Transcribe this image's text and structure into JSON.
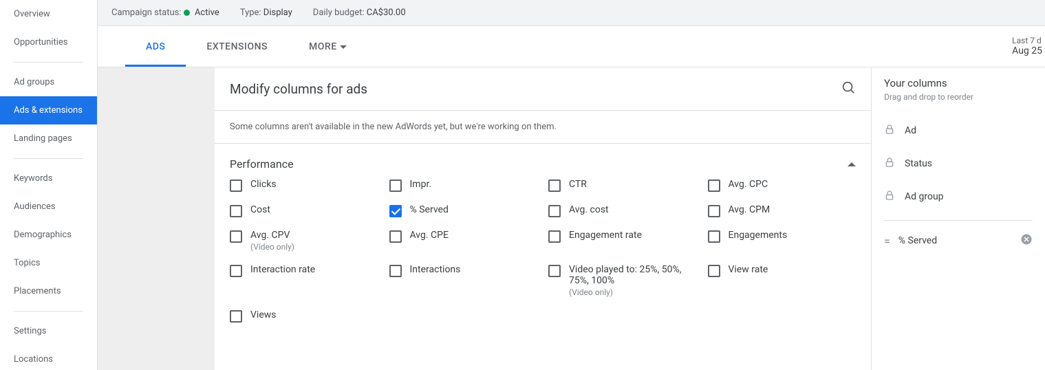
{
  "sidebar": {
    "items": [
      {
        "label": "Overview",
        "active": false
      },
      {
        "label": "Opportunities",
        "active": false
      },
      {
        "divider": true
      },
      {
        "label": "Ad groups",
        "active": false
      },
      {
        "label": "Ads & extensions",
        "active": true
      },
      {
        "label": "Landing pages",
        "active": false
      },
      {
        "divider": true
      },
      {
        "label": "Keywords",
        "active": false
      },
      {
        "label": "Audiences",
        "active": false
      },
      {
        "label": "Demographics",
        "active": false
      },
      {
        "label": "Topics",
        "active": false
      },
      {
        "label": "Placements",
        "active": false
      },
      {
        "divider": true
      },
      {
        "label": "Settings",
        "active": false
      },
      {
        "label": "Locations",
        "active": false
      }
    ]
  },
  "status_bar": {
    "campaign_status_label": "Campaign status:",
    "campaign_status_value": "Active",
    "type_label": "Type:",
    "type_value": "Display",
    "budget_label": "Daily budget:",
    "budget_value": "CA$30.00"
  },
  "tabs": {
    "items": [
      {
        "label": "ADS",
        "active": true
      },
      {
        "label": "EXTENSIONS",
        "active": false
      },
      {
        "label": "MORE",
        "active": false,
        "more": true
      }
    ]
  },
  "date_range": {
    "label": "Last 7 d",
    "value": "Aug 25"
  },
  "panel": {
    "title": "Modify columns for ads",
    "notice": "Some columns aren't available in the new AdWords yet, but we're working on them.",
    "section_title": "Performance",
    "metrics": [
      {
        "label": "Clicks",
        "checked": false
      },
      {
        "label": "Impr.",
        "checked": false
      },
      {
        "label": "CTR",
        "checked": false
      },
      {
        "label": "Avg. CPC",
        "checked": false
      },
      {
        "label": "Cost",
        "checked": false
      },
      {
        "label": "% Served",
        "checked": true
      },
      {
        "label": "Avg. cost",
        "checked": false
      },
      {
        "label": "Avg. CPM",
        "checked": false
      },
      {
        "label": "Avg. CPV",
        "sub": "(Video only)",
        "checked": false
      },
      {
        "label": "Avg. CPE",
        "checked": false
      },
      {
        "label": "Engagement rate",
        "checked": false
      },
      {
        "label": "Engagements",
        "checked": false
      },
      {
        "label": "Interaction rate",
        "checked": false
      },
      {
        "label": "Interactions",
        "checked": false
      },
      {
        "label": "Video played to: 25%, 50%, 75%, 100%",
        "sub": "(Video only)",
        "checked": false
      },
      {
        "label": "View rate",
        "checked": false
      },
      {
        "label": "Views",
        "checked": false
      }
    ]
  },
  "your_columns": {
    "title": "Your columns",
    "subtitle": "Drag and drop to reorder",
    "locked": [
      {
        "label": "Ad"
      },
      {
        "label": "Status"
      },
      {
        "label": "Ad group"
      }
    ],
    "draggable": [
      {
        "label": "% Served"
      }
    ]
  }
}
